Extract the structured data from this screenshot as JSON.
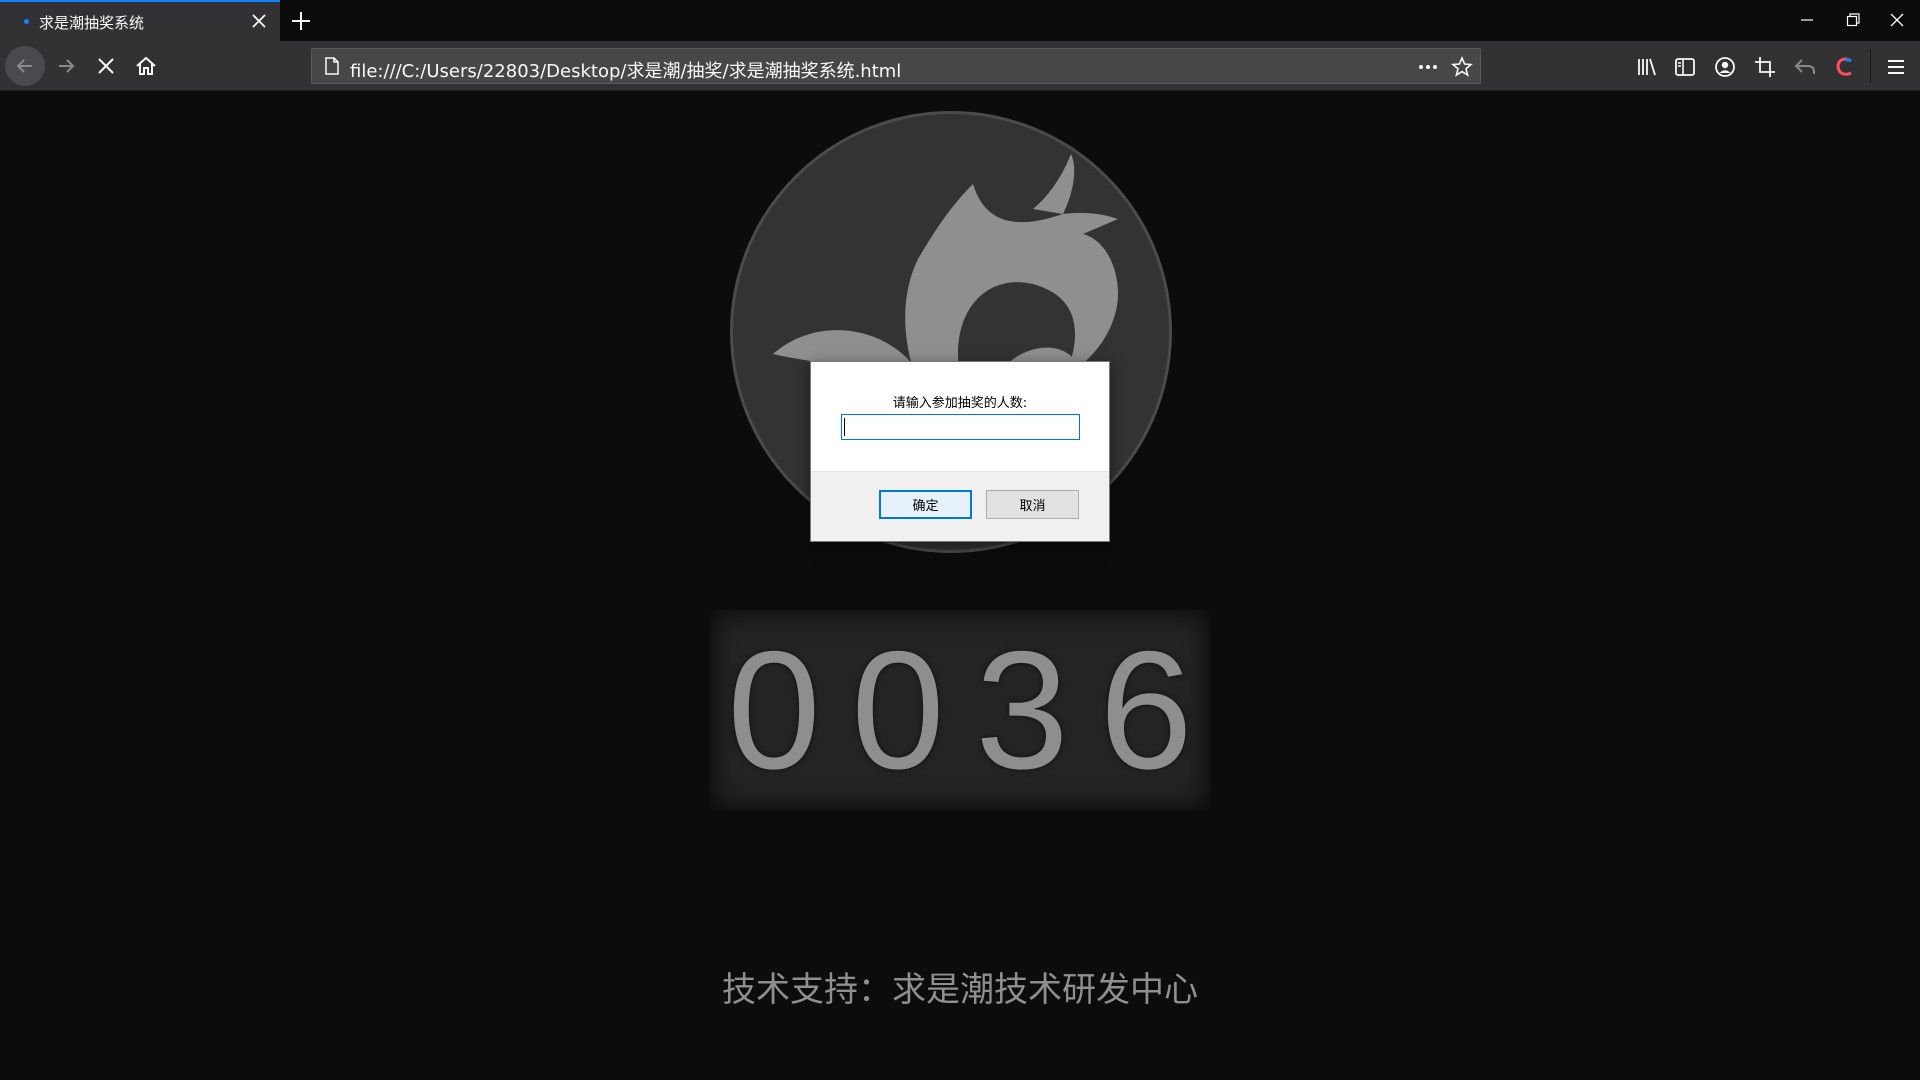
{
  "browser": {
    "tab_title": "求是潮抽奖系统",
    "url": "file:///C:/Users/22803/Desktop/求是潮/抽奖/求是潮抽奖系统.html"
  },
  "page": {
    "counter_digits": [
      "0",
      "0",
      "3",
      "6"
    ],
    "credit": "技术支持：求是潮技术研发中心"
  },
  "dialog": {
    "message": "请输入参加抽奖的人数:",
    "input_value": "",
    "ok_label": "确定",
    "cancel_label": "取消"
  },
  "colors": {
    "accent": "#0a84ff",
    "page_bg": "#0c0c0c",
    "digit": "#8e8e8e"
  }
}
